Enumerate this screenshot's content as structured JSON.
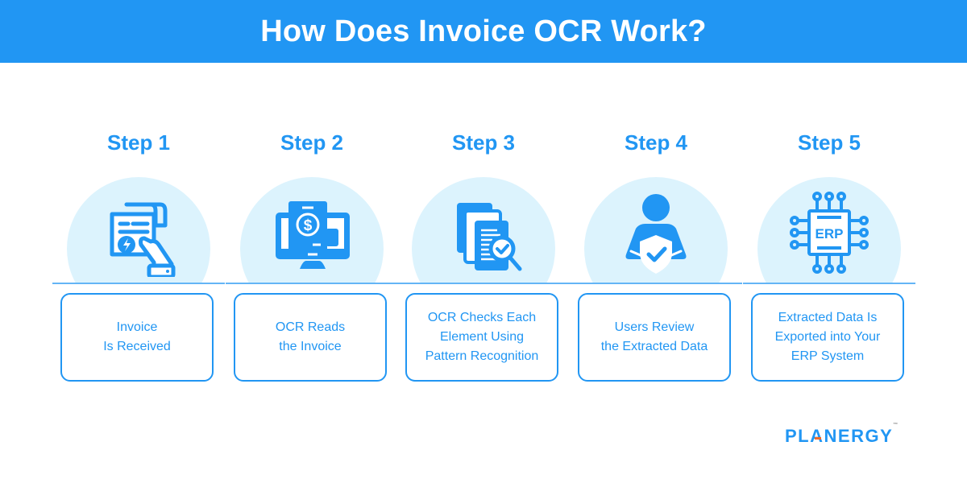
{
  "header": {
    "title": "How Does Invoice OCR Work?"
  },
  "colors": {
    "primary": "#2196f3",
    "circle": "#dcf3fd",
    "logo_accent": "#f06a2b"
  },
  "steps": [
    {
      "title": "Step 1",
      "icon": "hand-holding-invoice-icon",
      "lines": [
        "Invoice",
        "Is Received"
      ]
    },
    {
      "title": "Step 2",
      "icon": "monitor-invoice-dollar-icon",
      "lines": [
        "OCR Reads",
        "the Invoice"
      ]
    },
    {
      "title": "Step 3",
      "icon": "documents-magnifier-check-icon",
      "lines": [
        "OCR Checks Each",
        "Element Using",
        "Pattern Recognition"
      ]
    },
    {
      "title": "Step 4",
      "icon": "user-shield-check-icon",
      "lines": [
        "Users Review",
        "the Extracted Data"
      ]
    },
    {
      "title": "Step 5",
      "icon": "erp-chip-icon",
      "lines": [
        "Extracted Data Is",
        "Exported into Your",
        "ERP System"
      ]
    }
  ],
  "logo": {
    "prefix": "PL",
    "accent_letter": "A",
    "suffix": "NERGY",
    "tm": "™"
  }
}
